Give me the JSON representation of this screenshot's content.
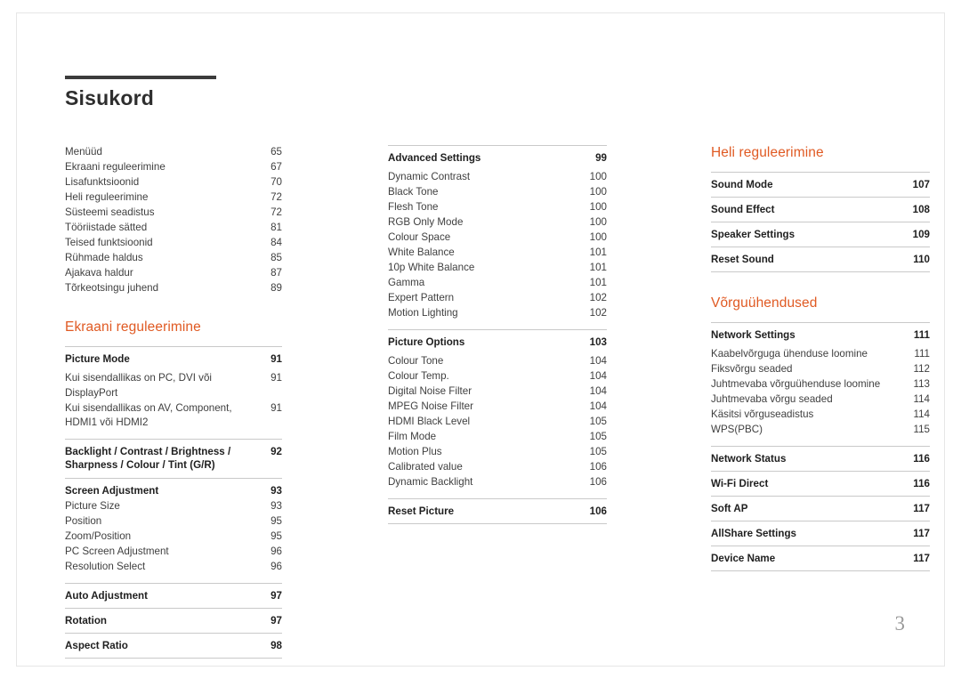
{
  "document": {
    "title": "Sisukord",
    "folio": "3",
    "accent_color": "#e05a23"
  },
  "columns": [
    {
      "id": "column-1",
      "blocks": [
        {
          "type": "list",
          "items": [
            {
              "label": "Menüüd",
              "page": "65"
            },
            {
              "label": "Ekraani reguleerimine",
              "page": "67"
            },
            {
              "label": "Lisafunktsioonid",
              "page": "70"
            },
            {
              "label": "Heli reguleerimine",
              "page": "72"
            },
            {
              "label": "Süsteemi seadistus",
              "page": "72"
            },
            {
              "label": "Tööriistade sätted",
              "page": "81"
            },
            {
              "label": "Teised funktsioonid",
              "page": "84"
            },
            {
              "label": "Rühmade haldus",
              "page": "85"
            },
            {
              "label": "Ajakava haldur",
              "page": "87"
            },
            {
              "label": "Tõrkeotsingu juhend",
              "page": "89"
            }
          ]
        },
        {
          "type": "heading",
          "label": "Ekraani reguleerimine"
        },
        {
          "type": "entries",
          "items": [
            {
              "style": "bold",
              "label": "Picture Mode",
              "page": "91"
            },
            {
              "style": "plain",
              "label": "Kui sisendallikas on PC, DVI või DisplayPort",
              "page": "91"
            },
            {
              "style": "wrap",
              "label": "Kui sisendallikas on AV, Component, HDMI1 või HDMI2",
              "page": "91"
            },
            {
              "style": "bold2",
              "label": "Backlight / Contrast / Brightness / Sharpness / Colour / Tint (G/R)",
              "page": "92"
            },
            {
              "style": "bold",
              "label": "Screen Adjustment",
              "page": "93"
            },
            {
              "style": "plain",
              "label": "Picture Size",
              "page": "93"
            },
            {
              "style": "plain",
              "label": "Position",
              "page": "95"
            },
            {
              "style": "plain",
              "label": "Zoom/Position",
              "page": "95"
            },
            {
              "style": "plain",
              "label": "PC Screen Adjustment",
              "page": "96"
            },
            {
              "style": "plain",
              "label": "Resolution Select",
              "page": "96"
            },
            {
              "style": "bold",
              "label": "Auto Adjustment",
              "page": "97"
            },
            {
              "style": "bold",
              "label": "Rotation",
              "page": "97"
            },
            {
              "style": "boldlast",
              "label": "Aspect Ratio",
              "page": "98"
            }
          ]
        }
      ]
    },
    {
      "id": "column-2",
      "blocks": [
        {
          "type": "entries",
          "items": [
            {
              "style": "bold",
              "label": "Advanced Settings",
              "page": "99"
            },
            {
              "style": "plain",
              "label": "Dynamic Contrast",
              "page": "100"
            },
            {
              "style": "plain",
              "label": "Black Tone",
              "page": "100"
            },
            {
              "style": "plain",
              "label": "Flesh Tone",
              "page": "100"
            },
            {
              "style": "plain",
              "label": "RGB Only Mode",
              "page": "100"
            },
            {
              "style": "plain",
              "label": "Colour Space",
              "page": "100"
            },
            {
              "style": "plain",
              "label": "White Balance",
              "page": "101"
            },
            {
              "style": "plain",
              "label": "10p White Balance",
              "page": "101"
            },
            {
              "style": "plain",
              "label": "Gamma",
              "page": "101"
            },
            {
              "style": "plain",
              "label": "Expert Pattern",
              "page": "102"
            },
            {
              "style": "plain",
              "label": "Motion Lighting",
              "page": "102"
            },
            {
              "style": "bold",
              "label": "Picture Options",
              "page": "103"
            },
            {
              "style": "plain",
              "label": "Colour Tone",
              "page": "104"
            },
            {
              "style": "plain",
              "label": "Colour Temp.",
              "page": "104"
            },
            {
              "style": "plain",
              "label": "Digital Noise Filter",
              "page": "104"
            },
            {
              "style": "plain",
              "label": "MPEG Noise Filter",
              "page": "104"
            },
            {
              "style": "plain",
              "label": "HDMI Black Level",
              "page": "105"
            },
            {
              "style": "plain",
              "label": "Film Mode",
              "page": "105"
            },
            {
              "style": "plain",
              "label": "Motion Plus",
              "page": "105"
            },
            {
              "style": "plain",
              "label": "Calibrated value",
              "page": "106"
            },
            {
              "style": "plain",
              "label": "Dynamic Backlight",
              "page": "106"
            },
            {
              "style": "boldlast",
              "label": "Reset Picture",
              "page": "106"
            }
          ]
        }
      ]
    },
    {
      "id": "column-3",
      "blocks": [
        {
          "type": "heading",
          "label": "Heli reguleerimine"
        },
        {
          "type": "entries",
          "items": [
            {
              "style": "bold",
              "label": "Sound Mode",
              "page": "107"
            },
            {
              "style": "bold",
              "label": "Sound Effect",
              "page": "108"
            },
            {
              "style": "bold",
              "label": "Speaker Settings",
              "page": "109"
            },
            {
              "style": "boldlast",
              "label": "Reset Sound",
              "page": "110"
            }
          ]
        },
        {
          "type": "heading",
          "label": "Võrguühendused"
        },
        {
          "type": "entries",
          "items": [
            {
              "style": "bold",
              "label": "Network Settings",
              "page": "111"
            },
            {
              "style": "plain",
              "label": "Kaabelvõrguga ühenduse loomine",
              "page": "111"
            },
            {
              "style": "plain",
              "label": "Fiksvõrgu seaded",
              "page": "112"
            },
            {
              "style": "plain",
              "label": "Juhtmevaba võrguühenduse loomine",
              "page": "113"
            },
            {
              "style": "plain",
              "label": "Juhtmevaba võrgu seaded",
              "page": "114"
            },
            {
              "style": "plain",
              "label": "Käsitsi võrguseadistus",
              "page": "114"
            },
            {
              "style": "plain",
              "label": "WPS(PBC)",
              "page": "115"
            },
            {
              "style": "bold",
              "label": "Network Status",
              "page": "116"
            },
            {
              "style": "bold",
              "label": "Wi-Fi Direct",
              "page": "116"
            },
            {
              "style": "bold",
              "label": "Soft AP",
              "page": "117"
            },
            {
              "style": "bold",
              "label": "AllShare Settings",
              "page": "117"
            },
            {
              "style": "boldlast",
              "label": "Device Name",
              "page": "117"
            }
          ]
        }
      ]
    }
  ]
}
